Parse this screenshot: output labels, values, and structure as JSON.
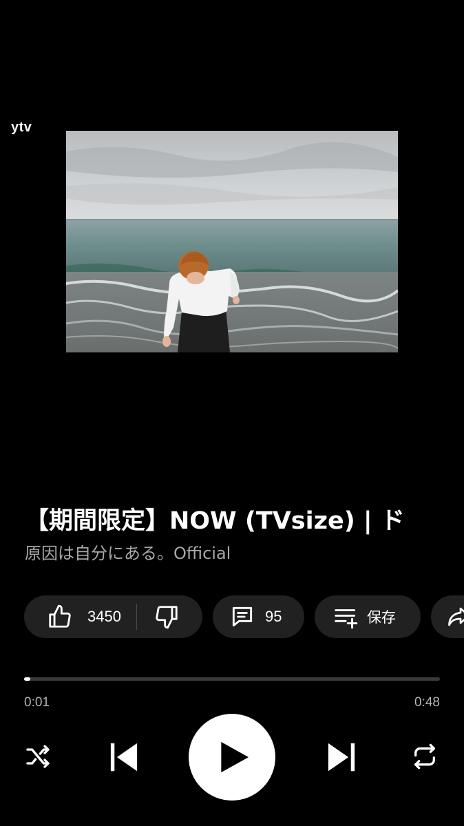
{
  "player": {
    "channel_logo": "ytv",
    "title": "【期間限定】NOW (TVsize) | ド",
    "artist": "原因は自分にある。Official"
  },
  "actions": {
    "like_count": "3450",
    "comment_count": "95",
    "save_label": "保存"
  },
  "progress": {
    "current": "0:01",
    "total": "0:48",
    "fraction": 0.015
  },
  "controls": {
    "shuffle": "shuffle-icon",
    "previous": "skip-previous-icon",
    "play": "play-icon",
    "next": "skip-next-icon",
    "repeat": "repeat-icon"
  },
  "colors": {
    "background": "#000000",
    "chip": "#212121",
    "secondary_text": "#a8a8a8",
    "track": "#3a3a3a"
  }
}
